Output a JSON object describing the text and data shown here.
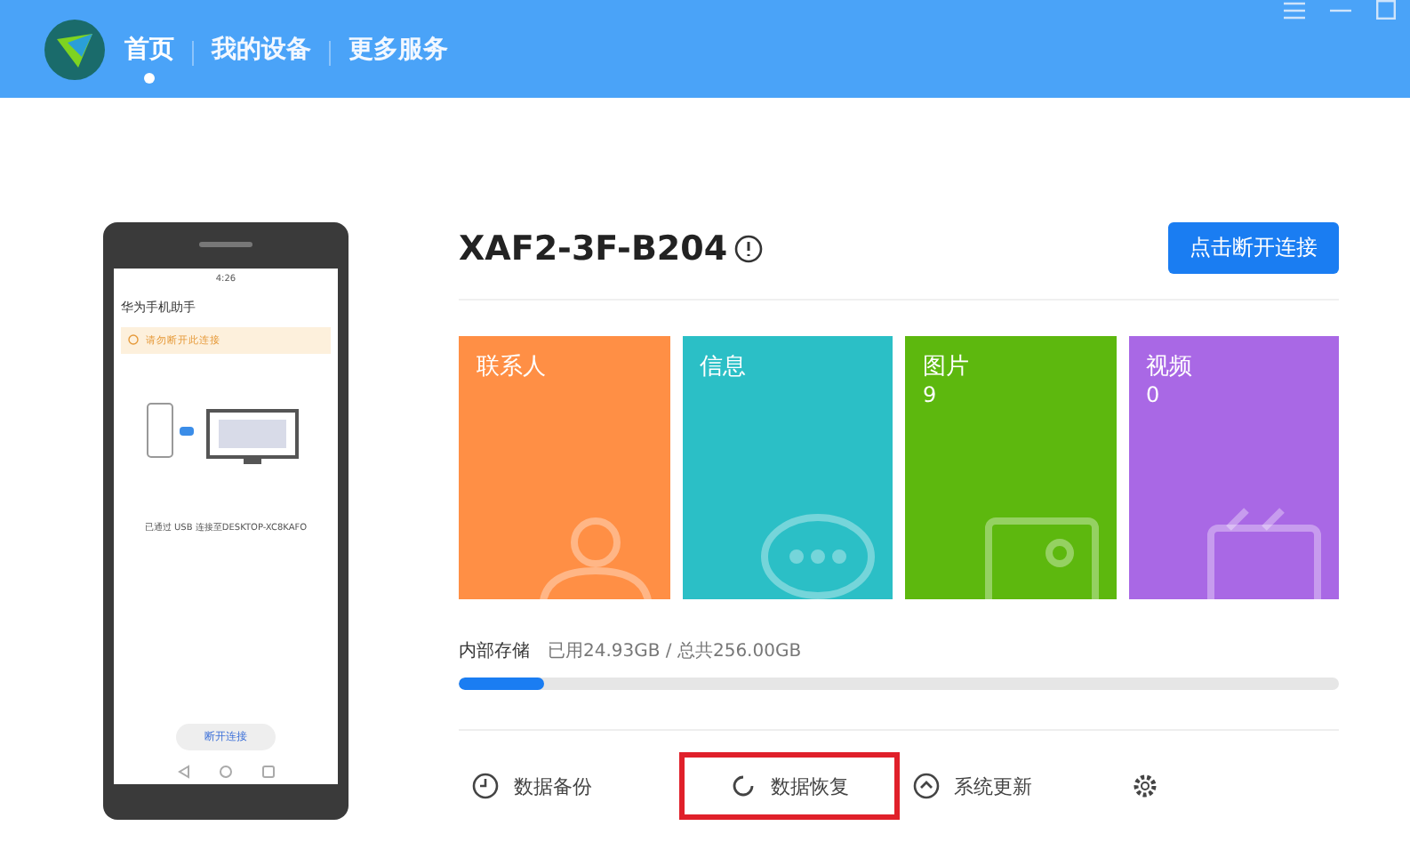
{
  "nav": {
    "tabs": [
      {
        "label": "首页",
        "selected": true
      },
      {
        "label": "我的设备",
        "selected": false
      },
      {
        "label": "更多服务",
        "selected": false
      }
    ]
  },
  "phone": {
    "status_time": "4:26",
    "app_title": "华为手机助手",
    "notice": "请勿断开此连接",
    "connection_text": "已通过 USB 连接至DESKTOP-XC8KAFO",
    "disconnect_button": "断开连接"
  },
  "device": {
    "name": "XAF2-3F-B204",
    "disconnect_button": "点击断开连接"
  },
  "tiles": [
    {
      "kind": "contacts",
      "label": "联系人",
      "color": "#ff8f45"
    },
    {
      "kind": "messages",
      "label": "信息",
      "color": "#2bbfc6"
    },
    {
      "kind": "photos",
      "label": "图片",
      "count": "9",
      "color": "#5db80e"
    },
    {
      "kind": "videos",
      "label": "视频",
      "count": "0",
      "color": "#a968e5"
    }
  ],
  "storage": {
    "label": "内部存储",
    "usage": "已用24.93GB / 总共256.00GB",
    "level": 0.097
  },
  "actions": [
    {
      "kind": "backup",
      "label": "数据备份",
      "highlighted": false
    },
    {
      "kind": "restore",
      "label": "数据恢复",
      "highlighted": true
    },
    {
      "kind": "update",
      "label": "系统更新",
      "highlighted": false
    },
    {
      "kind": "settings",
      "highlighted": false
    }
  ]
}
